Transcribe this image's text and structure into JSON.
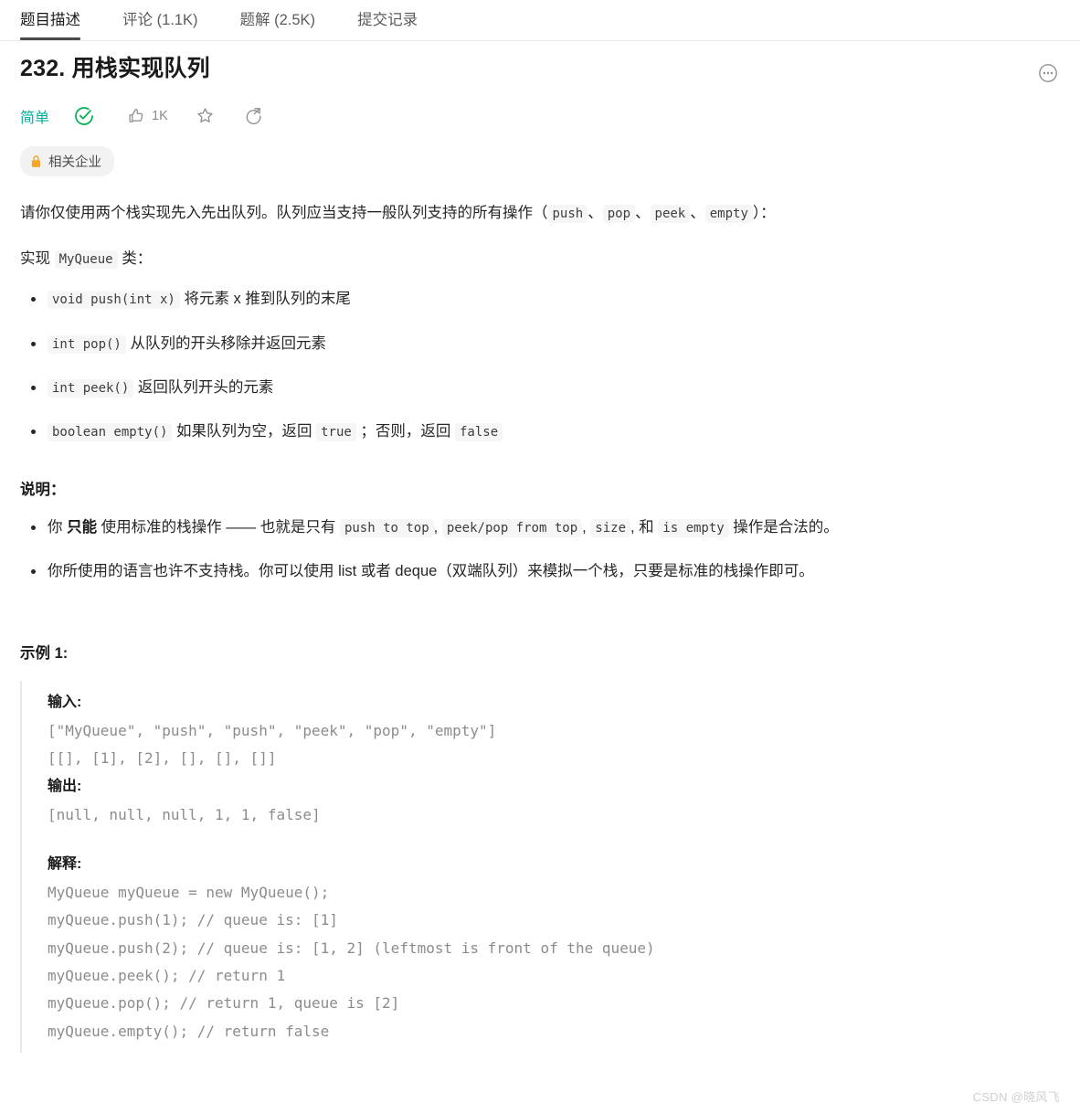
{
  "tabs": [
    {
      "label": "题目描述",
      "active": true
    },
    {
      "label": "评论 (1.1K)",
      "active": false
    },
    {
      "label": "题解 (2.5K)",
      "active": false
    },
    {
      "label": "提交记录",
      "active": false
    }
  ],
  "header": {
    "title": "232. 用栈实现队列",
    "difficulty": "简单",
    "difficulty_color": "#00af9b",
    "solved_color": "#00b04f",
    "like_count": "1K",
    "more_icon": "more-horizontal-circle-icon"
  },
  "company_badge": {
    "label": "相关企业",
    "lock_icon": "lock-icon",
    "lock_color": "#f5a623"
  },
  "intro": {
    "line1_a": "请你仅使用两个栈实现先入先出队列。队列应当支持一般队列支持的所有操作（",
    "code1": "push",
    "sep1": "、",
    "code2": "pop",
    "sep2": "、",
    "code3": "peek",
    "sep3": "、",
    "code4": "empty",
    "line1_b": "）：",
    "line2_a": "实现 ",
    "line2_code": "MyQueue",
    "line2_b": " 类："
  },
  "methods": [
    {
      "code": "void push(int x)",
      "desc": " 将元素 x 推到队列的末尾"
    },
    {
      "code": "int pop()",
      "desc": " 从队列的开头移除并返回元素"
    },
    {
      "code": "int peek()",
      "desc": " 返回队列开头的元素"
    }
  ],
  "method_empty": {
    "code": "boolean empty()",
    "desc_a": " 如果队列为空，返回 ",
    "code_true": "true",
    "desc_b": " ；否则，返回 ",
    "code_false": "false"
  },
  "notes": {
    "heading": "说明：",
    "item1": {
      "a": "你 ",
      "bold": "只能",
      "b": " 使用标准的栈操作 —— 也就是只有 ",
      "code1": "push to top",
      "c": ", ",
      "code2": "peek/pop from top",
      "d": ", ",
      "code3": "size",
      "e": ", 和 ",
      "code4": "is empty",
      "f": " 操作是合法的。"
    },
    "item2": "你所使用的语言也许不支持栈。你可以使用 list 或者 deque（双端队列）来模拟一个栈，只要是标准的栈操作即可。"
  },
  "example": {
    "heading": "示例 1:",
    "input_label": "输入:",
    "input_lines": [
      "[\"MyQueue\", \"push\", \"push\", \"peek\", \"pop\", \"empty\"]",
      "[[], [1], [2], [], [], []]"
    ],
    "output_label": "输出:",
    "output_lines": [
      "[null, null, null, 1, 1, false]"
    ],
    "explain_label": "解释:",
    "explain_lines": [
      "MyQueue myQueue = new MyQueue();",
      "myQueue.push(1); // queue is: [1]",
      "myQueue.push(2); // queue is: [1, 2] (leftmost is front of the queue)",
      "myQueue.peek(); // return 1",
      "myQueue.pop(); // return 1, queue is [2]",
      "myQueue.empty(); // return false"
    ]
  },
  "watermark": "CSDN @晓风飞"
}
